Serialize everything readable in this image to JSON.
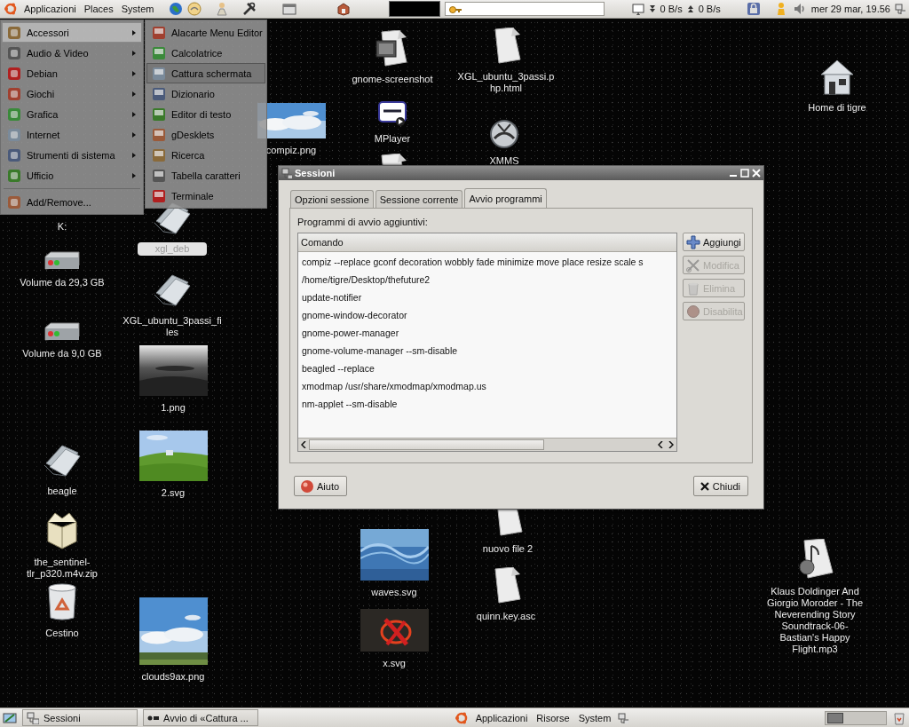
{
  "top_panel": {
    "menus": [
      "Applicazioni",
      "Places",
      "System"
    ],
    "network": {
      "download": "0 B/s",
      "upload": "0 B/s"
    },
    "clock": "mer 29 mar, 19.56"
  },
  "desktop_icons": [
    {
      "label": "gnome-screenshot",
      "kind": "screenshot"
    },
    {
      "label": "XGL_ubuntu_3passi.php.html",
      "kind": "document"
    },
    {
      "label": "Home di tigre",
      "kind": "home"
    },
    {
      "label": "compiz.png"
    },
    {
      "label": "MPlayer",
      "kind": "mplayer"
    },
    {
      "label": "XMMS",
      "kind": "xmms"
    },
    {
      "kind": "document"
    },
    {
      "label": "K:"
    },
    {
      "label": "xgl_deb",
      "kind": "folder",
      "selected": true
    },
    {
      "label": "Volume da 29,3 GB",
      "kind": "drive"
    },
    {
      "label": "XGL_ubuntu_3passi_files",
      "kind": "folder",
      "selected": false
    },
    {
      "label": "Volume da 9,0 GB",
      "kind": "drive"
    },
    {
      "label": "1.png"
    },
    {
      "label": "beagle",
      "kind": "folder",
      "selected": false
    },
    {
      "label": "2.svg"
    },
    {
      "label": "the_sentinel-tlr_p320.m4v.zip",
      "kind": "archive"
    },
    {
      "label": "Cestino",
      "kind": "trash"
    },
    {
      "label": "clouds9ax.png"
    },
    {
      "label": "waves.svg"
    },
    {
      "label": "x.svg"
    },
    {
      "label": "nuovo file 2",
      "kind": "document"
    },
    {
      "label": "quinn.key.asc",
      "kind": "document"
    },
    {
      "label": "Klaus Doldinger And Giorgio Moroder - The Neverending Story Soundtrack-06-Bastian's Happy Flight.mp3",
      "kind": "audio"
    }
  ],
  "main_menu": {
    "items": [
      {
        "label": "Accessori",
        "selected": true,
        "submenu": true,
        "separator_before": false
      },
      {
        "label": "Audio & Video",
        "selected": false,
        "submenu": true,
        "separator_before": false
      },
      {
        "label": "Debian",
        "selected": false,
        "submenu": true,
        "separator_before": false
      },
      {
        "label": "Giochi",
        "selected": false,
        "submenu": true,
        "separator_before": false
      },
      {
        "label": "Grafica",
        "selected": false,
        "submenu": true,
        "separator_before": false
      },
      {
        "label": "Internet",
        "selected": false,
        "submenu": true,
        "separator_before": false
      },
      {
        "label": "Strumenti di sistema",
        "selected": false,
        "submenu": true,
        "separator_before": false
      },
      {
        "label": "Ufficio",
        "selected": false,
        "submenu": true,
        "separator_before": false
      },
      {
        "label": "Add/Remove...",
        "selected": false,
        "submenu": false,
        "separator_before": true
      }
    ]
  },
  "submenu": {
    "items": [
      {
        "label": "Alacarte Menu Editor",
        "selected": false
      },
      {
        "label": "Calcolatrice",
        "selected": false
      },
      {
        "label": "Cattura schermata",
        "selected": true
      },
      {
        "label": "Dizionario",
        "selected": false
      },
      {
        "label": "Editor di testo",
        "selected": false
      },
      {
        "label": "gDesklets",
        "selected": false
      },
      {
        "label": "Ricerca",
        "selected": false
      },
      {
        "label": "Tabella caratteri",
        "selected": false
      },
      {
        "label": "Terminale",
        "selected": false
      }
    ]
  },
  "dialog": {
    "title": "Sessioni",
    "tabs": [
      {
        "label": "Opzioni sessione",
        "selected": false
      },
      {
        "label": "Sessione corrente",
        "selected": false
      },
      {
        "label": "Avvio programmi",
        "selected": true
      }
    ],
    "section_label": "Programmi di avvio aggiuntivi:",
    "list": {
      "column": "Comando",
      "rows": [
        "compiz --replace gconf decoration wobbly fade minimize move place resize scale s",
        "/home/tigre/Desktop/thefuture2",
        "update-notifier",
        "gnome-window-decorator",
        "gnome-power-manager",
        "gnome-volume-manager --sm-disable",
        "beagled --replace",
        "xmodmap /usr/share/xmodmap/xmodmap.us",
        "nm-applet --sm-disable"
      ]
    },
    "side_buttons": [
      {
        "label": "Aggiungi",
        "disabled": false
      },
      {
        "label": "Modifica",
        "disabled": true
      },
      {
        "label": "Elimina",
        "disabled": true
      },
      {
        "label": "Disabilita",
        "disabled": true
      }
    ],
    "help_button": "Aiuto",
    "close_button": "Chiudi"
  },
  "bottom_panel": {
    "tasks": [
      "Sessioni",
      "Avvio di «Cattura ..."
    ],
    "menus": [
      "Applicazioni",
      "Risorse",
      "System"
    ]
  }
}
